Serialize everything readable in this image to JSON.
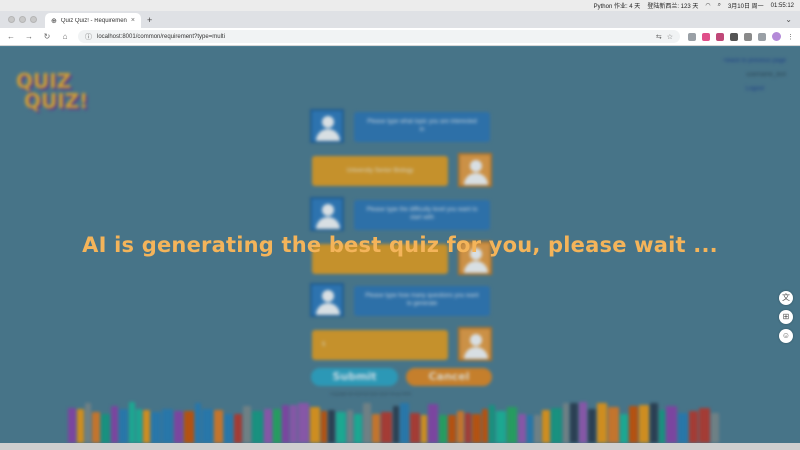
{
  "menubar": {
    "items": [
      "Python 作业: 4 天",
      "登陆新西兰: 123 天",
      "3月10日 周一",
      "01:55:12"
    ]
  },
  "browser": {
    "tab_title": "Quiz Quiz! - Requirements",
    "url": "localhost:8001/common/requirement?type=multi"
  },
  "page": {
    "logo_line1": "QUIZ",
    "logo_line2": "QUIZ!",
    "back_link": "<Back to previous page",
    "username": "username_text",
    "logout": "Logout",
    "chat": [
      {
        "side": "left",
        "text": "Please type what topic you are interested in"
      },
      {
        "side": "right",
        "text": "University Senior Biology"
      },
      {
        "side": "left",
        "text": "Please type the difficulty level you want to start with"
      },
      {
        "side": "right",
        "text": ""
      },
      {
        "side": "left",
        "text": "Please type how many questions you want to generate"
      },
      {
        "side": "right",
        "text": "5"
      }
    ],
    "submit_label": "Submit",
    "cancel_label": "Cancel",
    "footer_note": "Copyright all reserved Quiz Quiz! Group 9999",
    "loading_message": "AI is generating the best quiz for you, please wait ..."
  }
}
